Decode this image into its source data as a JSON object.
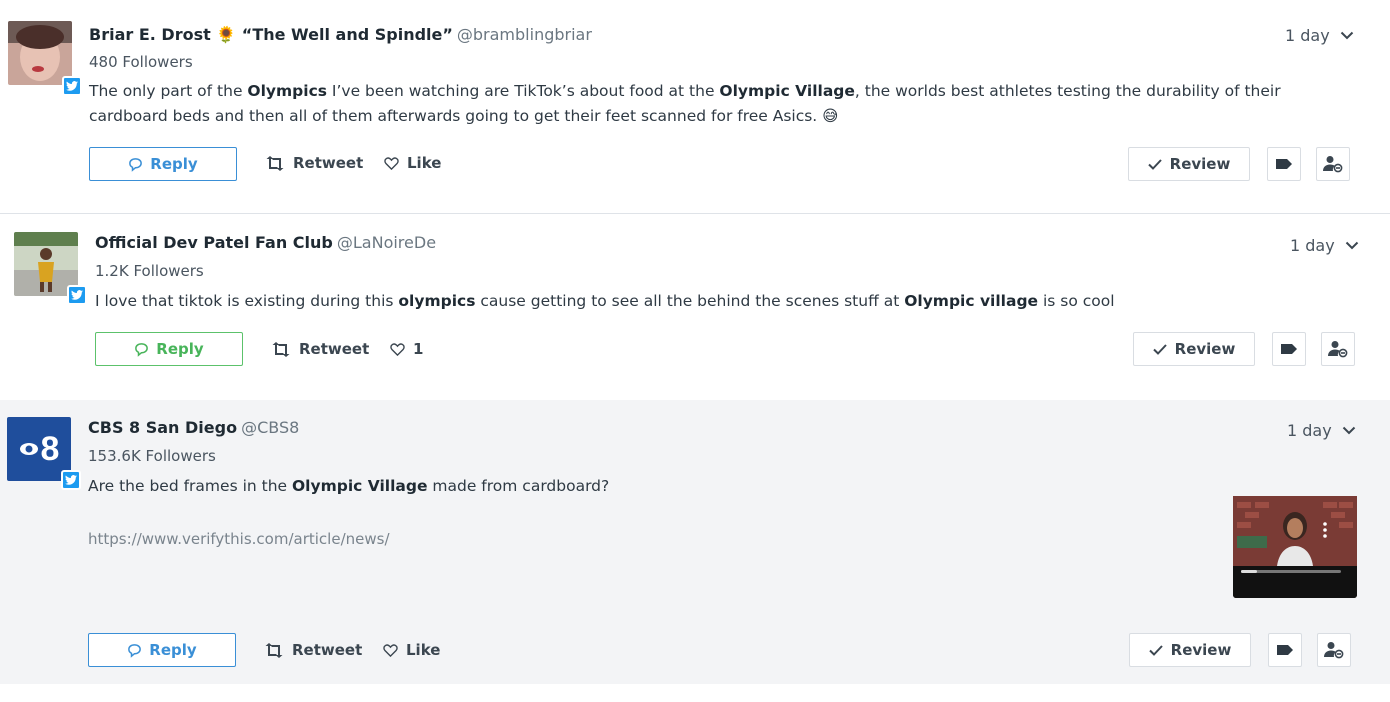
{
  "posts": [
    {
      "name": "Briar E. Drost 🌻 “The Well and Spindle”",
      "handle": "@bramblingbriar",
      "followers": "480 Followers",
      "time": "1 day",
      "text_parts": [
        "The only part of the ",
        "Olympics",
        " I’ve been watching are TikTok’s about food at the ",
        "Olympic Village",
        ", the worlds best athletes testing the durability of their cardboard beds and then all of them afterwards going to get their feet scanned for free Asics. 😅"
      ],
      "reply_label": "Reply",
      "retweet_label": "Retweet",
      "like_label": "Like",
      "review_label": "Review"
    },
    {
      "name": "Official Dev Patel Fan Club",
      "handle": "@LaNoireDe",
      "followers": "1.2K Followers",
      "time": "1 day",
      "text_parts": [
        "I love that tiktok is existing during this ",
        "olympics",
        " cause getting to see all the behind the scenes stuff at ",
        "Olympic village",
        " is so cool"
      ],
      "reply_label": "Reply",
      "retweet_label": "Retweet",
      "like_label": "1",
      "review_label": "Review"
    },
    {
      "name": "CBS 8 San Diego",
      "handle": "@CBS8",
      "followers": "153.6K Followers",
      "time": "1 day",
      "text_parts": [
        "Are the bed frames in the ",
        "Olympic Village",
        " made from cardboard?"
      ],
      "link": "https://www.verifythis.com/article/news/",
      "avatar_text": "8",
      "reply_label": "Reply",
      "retweet_label": "Retweet",
      "like_label": "Like",
      "review_label": "Review"
    }
  ],
  "colors": {
    "twitter_blue": "#1d9bf0",
    "reply_blue": "#3a8fd6",
    "reply_green": "#48b45a",
    "cbs_blue": "#1f4e9c",
    "highlight_bg": "#f3f4f6"
  },
  "icons": [
    "twitter-icon",
    "chevron-down-icon",
    "reply-icon",
    "retweet-icon",
    "heart-icon",
    "check-icon",
    "tag-icon",
    "assign-user-icon"
  ]
}
